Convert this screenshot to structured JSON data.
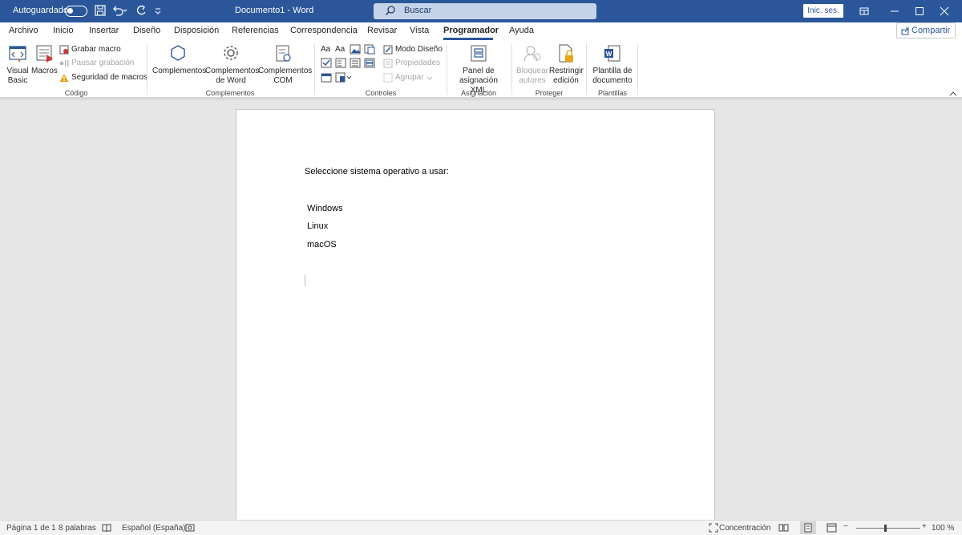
{
  "titlebar": {
    "autosave_label": "Autoguardado",
    "doc_title": "Documento1  -  Word",
    "search_label": "Buscar",
    "signin_label": "Inic. ses."
  },
  "tabs": [
    {
      "label": "Archivo"
    },
    {
      "label": "Inicio"
    },
    {
      "label": "Insertar"
    },
    {
      "label": "Diseño"
    },
    {
      "label": "Disposición"
    },
    {
      "label": "Referencias"
    },
    {
      "label": "Correspondencia"
    },
    {
      "label": "Revisar"
    },
    {
      "label": "Vista"
    },
    {
      "label": "Programador"
    },
    {
      "label": "Ayuda"
    }
  ],
  "share_label": "Compartir",
  "ribbon": {
    "codigo": {
      "label": "Código",
      "visual_basic": "Visual Basic",
      "macros": "Macros",
      "grabar": "Grabar macro",
      "pausar": "Pausar grabación",
      "seguridad": "Seguridad de macros"
    },
    "complementos": {
      "label": "Complementos",
      "complementos": "Complementos",
      "word": "Complementos de Word",
      "com": "Complementos COM"
    },
    "controles": {
      "label": "Controles",
      "modo_diseno": "Modo Diseño",
      "propiedades": "Propiedades",
      "agrupar": "Agrupar"
    },
    "asignacion": {
      "label": "Asignación",
      "panel": "Panel de asignación XML"
    },
    "proteger": {
      "label": "Proteger",
      "bloquear": "Bloquear autores",
      "restringir": "Restringir edición"
    },
    "plantillas": {
      "label": "Plantillas",
      "plantilla": "Plantilla de documento"
    }
  },
  "document": {
    "heading": "Seleccione sistema operativo a usar:",
    "options": [
      "Windows",
      "Linux",
      "macOS"
    ]
  },
  "statusbar": {
    "page": "Página 1 de 1",
    "words": "8 palabras",
    "language": "Español (España)",
    "focus": "Concentración",
    "zoom": "100 %"
  },
  "colors": {
    "accent": "#2b579a"
  }
}
